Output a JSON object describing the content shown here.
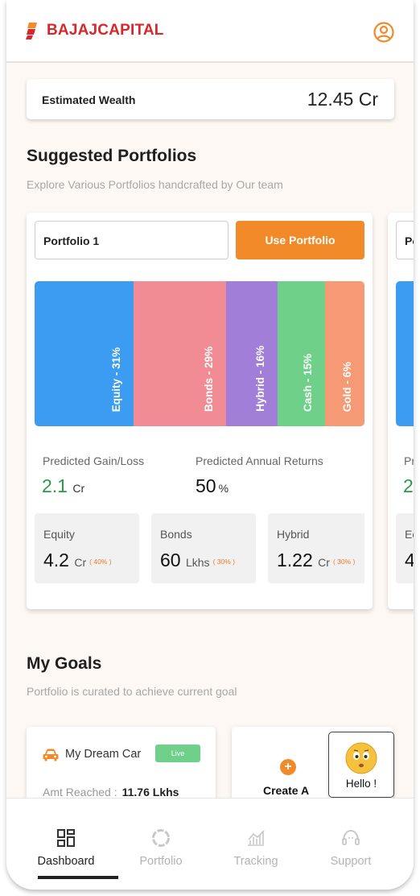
{
  "header": {
    "brand": "BAJAJCAPITAL",
    "brand_color": "#d9262a",
    "profile_icon": "user-circle-icon"
  },
  "wealth": {
    "label": "Estimated Wealth",
    "value": "12.45 Cr"
  },
  "suggested": {
    "title": "Suggested Portfolios",
    "subtitle": "Explore Various Portfolios handcrafted by Our team",
    "cards": [
      {
        "name": "Portfolio 1",
        "button": "Use Portfolio",
        "allocation": [
          {
            "label": "Equity - 31%",
            "percent": 31,
            "color": "#3b9cf2"
          },
          {
            "label": "Bonds - 29%",
            "percent": 29,
            "color": "#f18b94"
          },
          {
            "label": "Hybrid - 16%",
            "percent": 16,
            "color": "#a17ed8"
          },
          {
            "label": "Cash - 15%",
            "percent": 15,
            "color": "#6fd08a"
          },
          {
            "label": "Gold - 6%",
            "percent": 6,
            "color": "#f59a74"
          }
        ],
        "gain_label": "Predicted Gain/Loss",
        "gain_value": "2.1",
        "gain_unit": "Cr",
        "returns_label": "Predicted Annual Returns",
        "returns_value": "50",
        "returns_unit": "%",
        "assets": [
          {
            "name": "Equity",
            "value": "4.2",
            "unit": "Cr",
            "pct": "( 40% )"
          },
          {
            "name": "Bonds",
            "value": "60",
            "unit": "Lkhs",
            "pct": "( 30% )"
          },
          {
            "name": "Hybrid",
            "value": "1.22",
            "unit": "Cr",
            "pct": "( 30% )"
          }
        ]
      },
      {
        "name_partial": "Po",
        "stat_partial": "Pr",
        "gain_partial": "2",
        "asset_partial": "Ec",
        "asset_val_partial": "4"
      }
    ]
  },
  "goals": {
    "title": "My Goals",
    "subtitle": "Portfolio is curated to achieve current goal",
    "items": [
      {
        "icon": "car-icon",
        "name": "My Dream Car",
        "badge": "Live",
        "amt_label": "Amt Reached :",
        "amt_value": "11.76 Lkhs"
      }
    ],
    "create_label": "Create A"
  },
  "assistant": {
    "icon": "emoji-face-icon",
    "label": "Hello !"
  },
  "nav": [
    {
      "label": "Dashboard",
      "icon": "grid-icon",
      "active": true
    },
    {
      "label": "Portfolio",
      "icon": "donut-icon",
      "active": false
    },
    {
      "label": "Tracking",
      "icon": "chart-icon",
      "active": false
    },
    {
      "label": "Support",
      "icon": "support-icon",
      "active": false
    }
  ]
}
